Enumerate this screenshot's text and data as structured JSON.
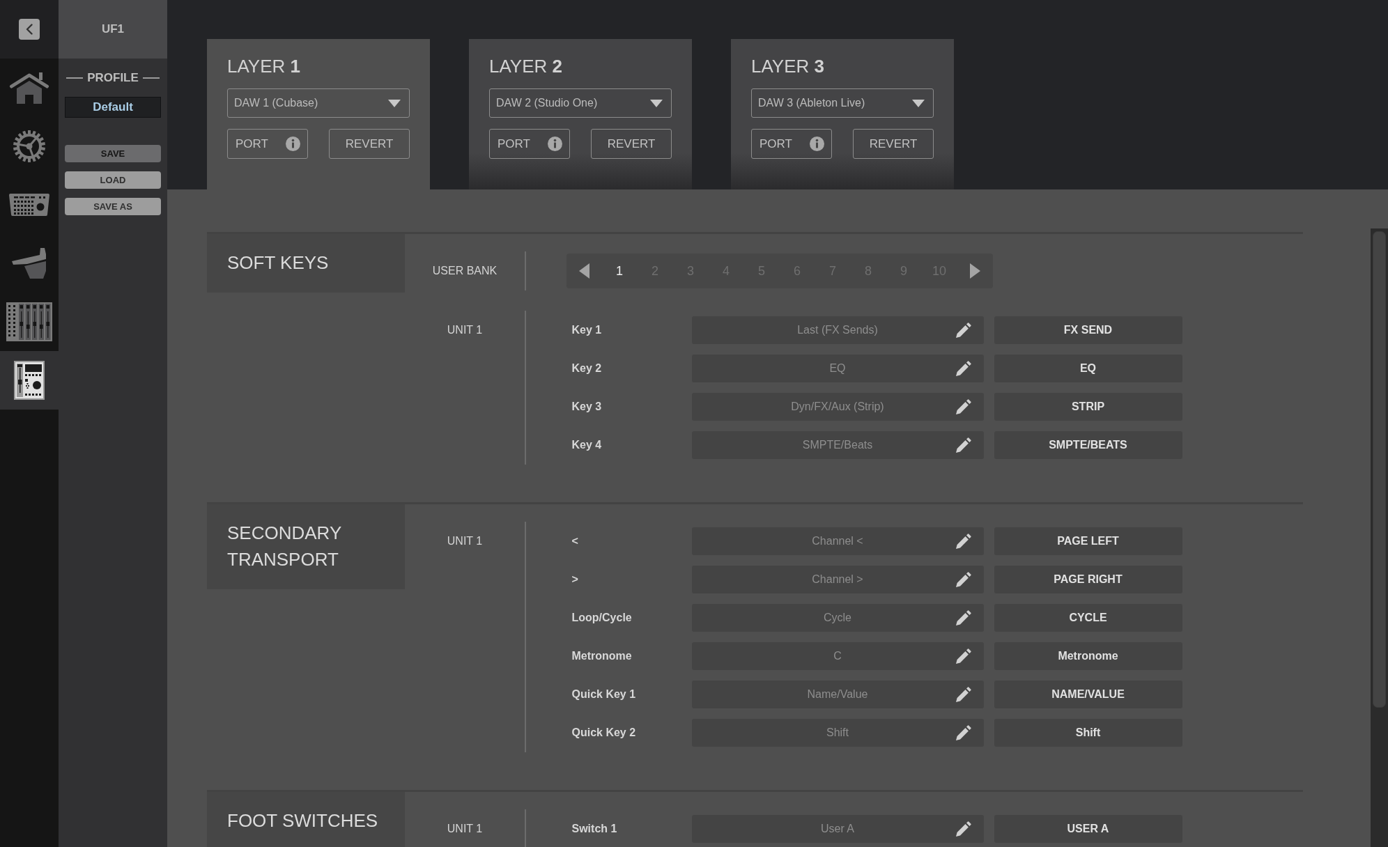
{
  "nav": {
    "items": [
      {
        "kind": "home",
        "selected": false
      },
      {
        "kind": "gear",
        "selected": false
      },
      {
        "kind": "surface",
        "selected": false
      },
      {
        "kind": "stand",
        "selected": false
      },
      {
        "kind": "mixer",
        "selected": false
      },
      {
        "kind": "unit",
        "selected": true
      }
    ]
  },
  "device": {
    "title": "UF1"
  },
  "profile": {
    "heading": "PROFILE",
    "name": "Default",
    "buttons": [
      {
        "label": "SAVE",
        "disabled": true
      },
      {
        "label": "LOAD",
        "disabled": false
      },
      {
        "label": "SAVE AS",
        "disabled": false
      }
    ]
  },
  "layers": [
    {
      "title": "LAYER **1**",
      "daw": "DAW 1 (Cubase)",
      "port": "PORT",
      "revert": "REVERT",
      "selected": true
    },
    {
      "title": "LAYER **2**",
      "daw": "DAW 2 (Studio One)",
      "port": "PORT",
      "revert": "REVERT",
      "selected": false
    },
    {
      "title": "LAYER **3**",
      "daw": "DAW 3 (Ableton Live)",
      "port": "PORT",
      "revert": "REVERT",
      "selected": false
    }
  ],
  "sections": [
    {
      "title": "SOFT KEYS",
      "bank": {
        "label": "USER BANK",
        "pages": [
          {
            "label": "1",
            "selected": true
          },
          {
            "label": "2",
            "selected": false
          },
          {
            "label": "3",
            "selected": false
          },
          {
            "label": "4",
            "selected": false
          },
          {
            "label": "5",
            "selected": false
          },
          {
            "label": "6",
            "selected": false
          },
          {
            "label": "7",
            "selected": false
          },
          {
            "label": "8",
            "selected": false
          },
          {
            "label": "9",
            "selected": false
          },
          {
            "label": "10",
            "selected": false
          }
        ]
      },
      "units": [
        {
          "label": "UNIT 1",
          "rows": [
            {
              "key": "Key 1",
              "assignment": "Last (FX Sends)",
              "name": "FX SEND"
            },
            {
              "key": "Key 2",
              "assignment": "EQ",
              "name": "EQ"
            },
            {
              "key": "Key 3",
              "assignment": "Dyn/FX/Aux (Strip)",
              "name": "STRIP"
            },
            {
              "key": "Key 4",
              "assignment": "SMPTE/Beats",
              "name": "SMPTE/BEATS"
            }
          ]
        }
      ]
    },
    {
      "title": "SECONDARY TRANSPORT",
      "units": [
        {
          "label": "UNIT 1",
          "rows": [
            {
              "key": "<",
              "assignment": "Channel <",
              "name": "PAGE LEFT"
            },
            {
              "key": ">",
              "assignment": "Channel >",
              "name": "PAGE RIGHT"
            },
            {
              "key": "Loop/Cycle",
              "assignment": "Cycle",
              "name": "CYCLE"
            },
            {
              "key": "Metronome",
              "assignment": "C",
              "name": "Metronome"
            },
            {
              "key": "Quick Key 1",
              "assignment": "Name/Value",
              "name": "NAME/VALUE"
            },
            {
              "key": "Quick Key 2",
              "assignment": "Shift",
              "name": "Shift"
            }
          ]
        }
      ]
    },
    {
      "title": "FOOT SWITCHES",
      "units": [
        {
          "label": "UNIT 1",
          "rows": [
            {
              "key": "Switch 1",
              "assignment": "User A",
              "name": "USER A"
            }
          ]
        }
      ]
    }
  ]
}
